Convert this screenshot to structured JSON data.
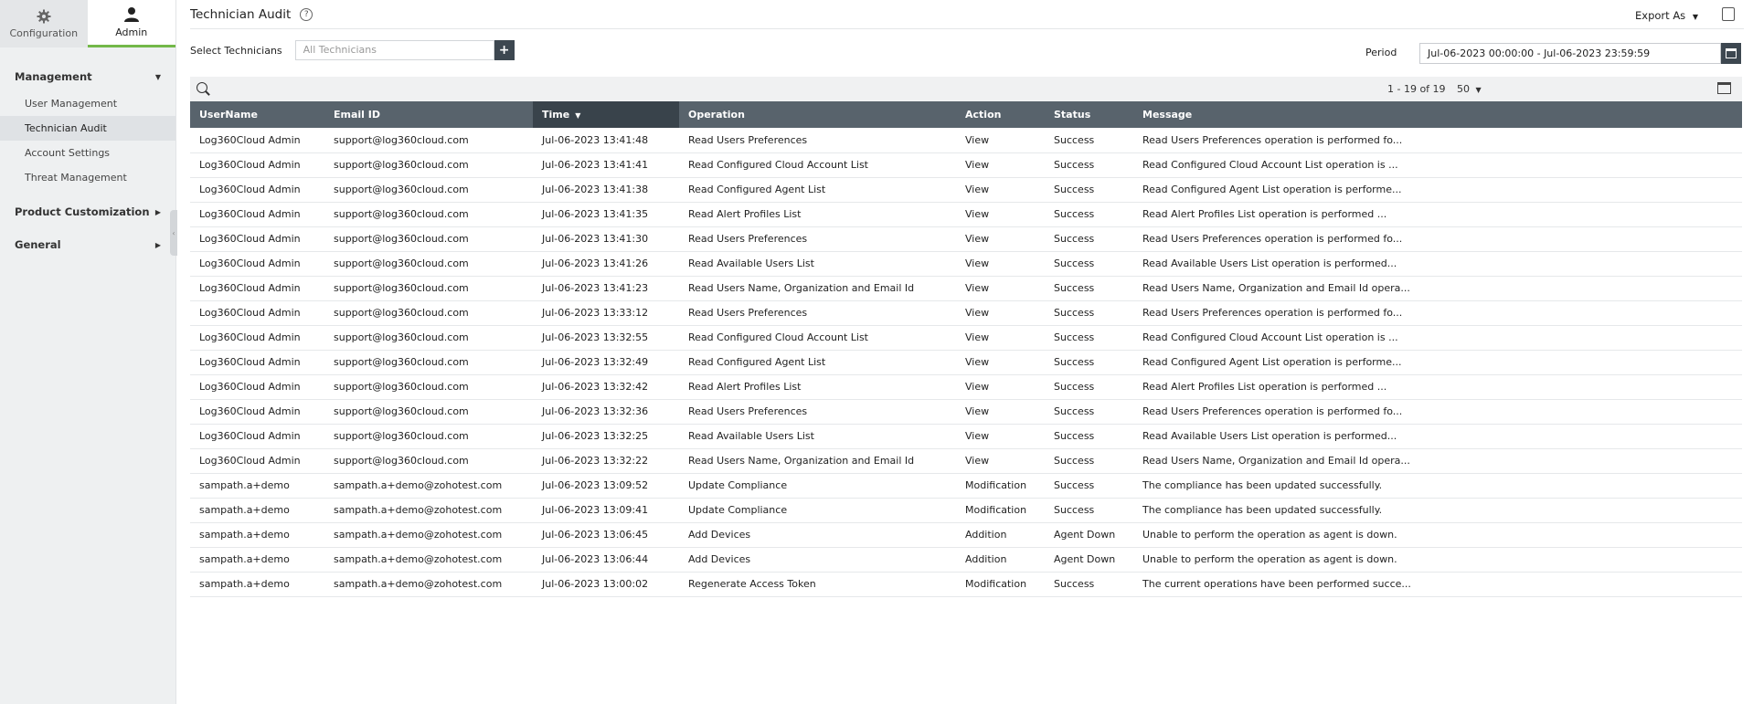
{
  "sidebar": {
    "tabs": [
      {
        "label": "Configuration",
        "icon": "gear-icon"
      },
      {
        "label": "Admin",
        "icon": "user-icon"
      }
    ],
    "sections": [
      {
        "label": "Management",
        "items": [
          "User Management",
          "Technician Audit",
          "Account Settings",
          "Threat Management"
        ]
      },
      {
        "label": "Product Customization"
      },
      {
        "label": "General"
      }
    ]
  },
  "header": {
    "title": "Technician Audit",
    "help_icon": "?",
    "export_label": "Export As"
  },
  "filter": {
    "label": "Select Technicians",
    "placeholder": "All Technicians",
    "add_label": "+"
  },
  "period": {
    "label": "Period",
    "value": "Jul-06-2023 00:00:00 - Jul-06-2023 23:59:59"
  },
  "toolbar": {
    "page_info": "1 - 19 of 19",
    "page_size": "50"
  },
  "table": {
    "columns": [
      "UserName",
      "Email ID",
      "Time",
      "Operation",
      "Action",
      "Status",
      "Message"
    ],
    "rows": [
      [
        "Log360Cloud Admin",
        "support@log360cloud.com",
        "Jul-06-2023 13:41:48",
        "Read Users Preferences",
        "View",
        "Success",
        "Read Users Preferences operation is performed fo..."
      ],
      [
        "Log360Cloud Admin",
        "support@log360cloud.com",
        "Jul-06-2023 13:41:41",
        "Read Configured Cloud Account List",
        "View",
        "Success",
        "Read Configured Cloud Account List operation is ..."
      ],
      [
        "Log360Cloud Admin",
        "support@log360cloud.com",
        "Jul-06-2023 13:41:38",
        "Read Configured Agent List",
        "View",
        "Success",
        "Read Configured Agent List operation is performe..."
      ],
      [
        "Log360Cloud Admin",
        "support@log360cloud.com",
        "Jul-06-2023 13:41:35",
        "Read Alert Profiles List",
        "View",
        "Success",
        "Read Alert Profiles List operation is performed ..."
      ],
      [
        "Log360Cloud Admin",
        "support@log360cloud.com",
        "Jul-06-2023 13:41:30",
        "Read Users Preferences",
        "View",
        "Success",
        "Read Users Preferences operation is performed fo..."
      ],
      [
        "Log360Cloud Admin",
        "support@log360cloud.com",
        "Jul-06-2023 13:41:26",
        "Read Available Users List",
        "View",
        "Success",
        "Read Available Users List operation is performed..."
      ],
      [
        "Log360Cloud Admin",
        "support@log360cloud.com",
        "Jul-06-2023 13:41:23",
        "Read Users Name, Organization and Email Id",
        "View",
        "Success",
        "Read Users Name, Organization and Email Id opera..."
      ],
      [
        "Log360Cloud Admin",
        "support@log360cloud.com",
        "Jul-06-2023 13:33:12",
        "Read Users Preferences",
        "View",
        "Success",
        "Read Users Preferences operation is performed fo..."
      ],
      [
        "Log360Cloud Admin",
        "support@log360cloud.com",
        "Jul-06-2023 13:32:55",
        "Read Configured Cloud Account List",
        "View",
        "Success",
        "Read Configured Cloud Account List operation is ..."
      ],
      [
        "Log360Cloud Admin",
        "support@log360cloud.com",
        "Jul-06-2023 13:32:49",
        "Read Configured Agent List",
        "View",
        "Success",
        "Read Configured Agent List operation is performe..."
      ],
      [
        "Log360Cloud Admin",
        "support@log360cloud.com",
        "Jul-06-2023 13:32:42",
        "Read Alert Profiles List",
        "View",
        "Success",
        "Read Alert Profiles List operation is performed ..."
      ],
      [
        "Log360Cloud Admin",
        "support@log360cloud.com",
        "Jul-06-2023 13:32:36",
        "Read Users Preferences",
        "View",
        "Success",
        "Read Users Preferences operation is performed fo..."
      ],
      [
        "Log360Cloud Admin",
        "support@log360cloud.com",
        "Jul-06-2023 13:32:25",
        "Read Available Users List",
        "View",
        "Success",
        "Read Available Users List operation is performed..."
      ],
      [
        "Log360Cloud Admin",
        "support@log360cloud.com",
        "Jul-06-2023 13:32:22",
        "Read Users Name, Organization and Email Id",
        "View",
        "Success",
        "Read Users Name, Organization and Email Id opera..."
      ],
      [
        "sampath.a+demo",
        "sampath.a+demo@zohotest.com",
        "Jul-06-2023 13:09:52",
        "Update Compliance",
        "Modification",
        "Success",
        "The compliance has been updated successfully."
      ],
      [
        "sampath.a+demo",
        "sampath.a+demo@zohotest.com",
        "Jul-06-2023 13:09:41",
        "Update Compliance",
        "Modification",
        "Success",
        "The compliance has been updated successfully."
      ],
      [
        "sampath.a+demo",
        "sampath.a+demo@zohotest.com",
        "Jul-06-2023 13:06:45",
        "Add Devices",
        "Addition",
        "Agent Down",
        "Unable to perform the operation as agent is down."
      ],
      [
        "sampath.a+demo",
        "sampath.a+demo@zohotest.com",
        "Jul-06-2023 13:06:44",
        "Add Devices",
        "Addition",
        "Agent Down",
        "Unable to perform the operation as agent is down."
      ],
      [
        "sampath.a+demo",
        "sampath.a+demo@zohotest.com",
        "Jul-06-2023 13:00:02",
        "Regenerate Access Token",
        "Modification",
        "Success",
        "The current operations have been performed succe..."
      ]
    ]
  },
  "colors": {
    "accent": "#73b849",
    "header_bg": "#58636c",
    "sorted_header_bg": "#39434b",
    "sidebar_bg": "#eef0f1"
  }
}
